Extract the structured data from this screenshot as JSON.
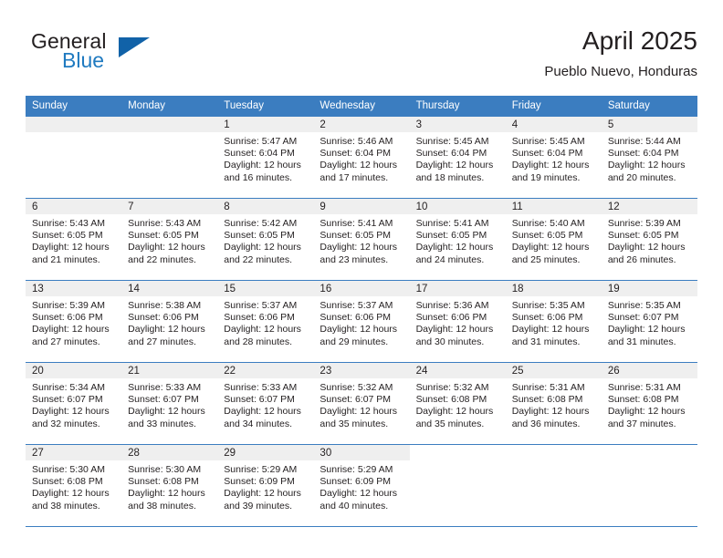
{
  "brand": {
    "word_one": "General",
    "word_two": "Blue",
    "triangle_icon": "triangle-icon",
    "accent_color": "#1162a8",
    "blue_text_color": "#1f7ac0"
  },
  "header": {
    "title": "April 2025",
    "subtitle": "Pueblo Nuevo, Honduras"
  },
  "theme": {
    "header_band": "#3b7dc0",
    "daynum_strip": "#efefef",
    "text": "#231f20"
  },
  "weekday_headers": [
    "Sunday",
    "Monday",
    "Tuesday",
    "Wednesday",
    "Thursday",
    "Friday",
    "Saturday"
  ],
  "labels": {
    "sunrise_prefix": "Sunrise:",
    "sunset_prefix": "Sunset:",
    "daylight_prefix": "Daylight:"
  },
  "weeks": [
    [
      {
        "day": "",
        "empty": true
      },
      {
        "day": "",
        "empty": true
      },
      {
        "day": "1",
        "sunrise": "Sunrise: 5:47 AM",
        "sunset": "Sunset: 6:04 PM",
        "daylight": "Daylight: 12 hours and 16 minutes."
      },
      {
        "day": "2",
        "sunrise": "Sunrise: 5:46 AM",
        "sunset": "Sunset: 6:04 PM",
        "daylight": "Daylight: 12 hours and 17 minutes."
      },
      {
        "day": "3",
        "sunrise": "Sunrise: 5:45 AM",
        "sunset": "Sunset: 6:04 PM",
        "daylight": "Daylight: 12 hours and 18 minutes."
      },
      {
        "day": "4",
        "sunrise": "Sunrise: 5:45 AM",
        "sunset": "Sunset: 6:04 PM",
        "daylight": "Daylight: 12 hours and 19 minutes."
      },
      {
        "day": "5",
        "sunrise": "Sunrise: 5:44 AM",
        "sunset": "Sunset: 6:04 PM",
        "daylight": "Daylight: 12 hours and 20 minutes."
      }
    ],
    [
      {
        "day": "6",
        "sunrise": "Sunrise: 5:43 AM",
        "sunset": "Sunset: 6:05 PM",
        "daylight": "Daylight: 12 hours and 21 minutes."
      },
      {
        "day": "7",
        "sunrise": "Sunrise: 5:43 AM",
        "sunset": "Sunset: 6:05 PM",
        "daylight": "Daylight: 12 hours and 22 minutes."
      },
      {
        "day": "8",
        "sunrise": "Sunrise: 5:42 AM",
        "sunset": "Sunset: 6:05 PM",
        "daylight": "Daylight: 12 hours and 22 minutes."
      },
      {
        "day": "9",
        "sunrise": "Sunrise: 5:41 AM",
        "sunset": "Sunset: 6:05 PM",
        "daylight": "Daylight: 12 hours and 23 minutes."
      },
      {
        "day": "10",
        "sunrise": "Sunrise: 5:41 AM",
        "sunset": "Sunset: 6:05 PM",
        "daylight": "Daylight: 12 hours and 24 minutes."
      },
      {
        "day": "11",
        "sunrise": "Sunrise: 5:40 AM",
        "sunset": "Sunset: 6:05 PM",
        "daylight": "Daylight: 12 hours and 25 minutes."
      },
      {
        "day": "12",
        "sunrise": "Sunrise: 5:39 AM",
        "sunset": "Sunset: 6:05 PM",
        "daylight": "Daylight: 12 hours and 26 minutes."
      }
    ],
    [
      {
        "day": "13",
        "sunrise": "Sunrise: 5:39 AM",
        "sunset": "Sunset: 6:06 PM",
        "daylight": "Daylight: 12 hours and 27 minutes."
      },
      {
        "day": "14",
        "sunrise": "Sunrise: 5:38 AM",
        "sunset": "Sunset: 6:06 PM",
        "daylight": "Daylight: 12 hours and 27 minutes."
      },
      {
        "day": "15",
        "sunrise": "Sunrise: 5:37 AM",
        "sunset": "Sunset: 6:06 PM",
        "daylight": "Daylight: 12 hours and 28 minutes."
      },
      {
        "day": "16",
        "sunrise": "Sunrise: 5:37 AM",
        "sunset": "Sunset: 6:06 PM",
        "daylight": "Daylight: 12 hours and 29 minutes."
      },
      {
        "day": "17",
        "sunrise": "Sunrise: 5:36 AM",
        "sunset": "Sunset: 6:06 PM",
        "daylight": "Daylight: 12 hours and 30 minutes."
      },
      {
        "day": "18",
        "sunrise": "Sunrise: 5:35 AM",
        "sunset": "Sunset: 6:06 PM",
        "daylight": "Daylight: 12 hours and 31 minutes."
      },
      {
        "day": "19",
        "sunrise": "Sunrise: 5:35 AM",
        "sunset": "Sunset: 6:07 PM",
        "daylight": "Daylight: 12 hours and 31 minutes."
      }
    ],
    [
      {
        "day": "20",
        "sunrise": "Sunrise: 5:34 AM",
        "sunset": "Sunset: 6:07 PM",
        "daylight": "Daylight: 12 hours and 32 minutes."
      },
      {
        "day": "21",
        "sunrise": "Sunrise: 5:33 AM",
        "sunset": "Sunset: 6:07 PM",
        "daylight": "Daylight: 12 hours and 33 minutes."
      },
      {
        "day": "22",
        "sunrise": "Sunrise: 5:33 AM",
        "sunset": "Sunset: 6:07 PM",
        "daylight": "Daylight: 12 hours and 34 minutes."
      },
      {
        "day": "23",
        "sunrise": "Sunrise: 5:32 AM",
        "sunset": "Sunset: 6:07 PM",
        "daylight": "Daylight: 12 hours and 35 minutes."
      },
      {
        "day": "24",
        "sunrise": "Sunrise: 5:32 AM",
        "sunset": "Sunset: 6:08 PM",
        "daylight": "Daylight: 12 hours and 35 minutes."
      },
      {
        "day": "25",
        "sunrise": "Sunrise: 5:31 AM",
        "sunset": "Sunset: 6:08 PM",
        "daylight": "Daylight: 12 hours and 36 minutes."
      },
      {
        "day": "26",
        "sunrise": "Sunrise: 5:31 AM",
        "sunset": "Sunset: 6:08 PM",
        "daylight": "Daylight: 12 hours and 37 minutes."
      }
    ],
    [
      {
        "day": "27",
        "sunrise": "Sunrise: 5:30 AM",
        "sunset": "Sunset: 6:08 PM",
        "daylight": "Daylight: 12 hours and 38 minutes."
      },
      {
        "day": "28",
        "sunrise": "Sunrise: 5:30 AM",
        "sunset": "Sunset: 6:08 PM",
        "daylight": "Daylight: 12 hours and 38 minutes."
      },
      {
        "day": "29",
        "sunrise": "Sunrise: 5:29 AM",
        "sunset": "Sunset: 6:09 PM",
        "daylight": "Daylight: 12 hours and 39 minutes."
      },
      {
        "day": "30",
        "sunrise": "Sunrise: 5:29 AM",
        "sunset": "Sunset: 6:09 PM",
        "daylight": "Daylight: 12 hours and 40 minutes."
      },
      {
        "day": "",
        "empty": true,
        "blank": true
      },
      {
        "day": "",
        "empty": true,
        "blank": true
      },
      {
        "day": "",
        "empty": true,
        "blank": true
      }
    ]
  ]
}
